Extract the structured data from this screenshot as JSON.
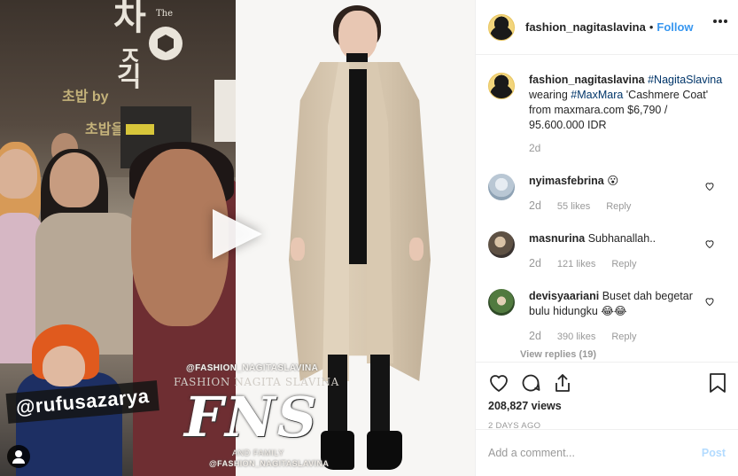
{
  "header": {
    "username": "fashion_nagitaslavina",
    "separator": "•",
    "follow_label": "Follow"
  },
  "caption": {
    "username": "fashion_nagitaslavina",
    "hashtag1": "#NagitaSlavina",
    "text1": "wearing",
    "hashtag2": "#MaxMara",
    "text2": "'Cashmere Coat' from maxmara.com $6,790 / 95.600.000 IDR",
    "age": "2d"
  },
  "comments": [
    {
      "username": "nyimasfebrina",
      "text": "😮",
      "age": "2d",
      "likes": "55 likes",
      "reply_label": "Reply"
    },
    {
      "username": "masnurina",
      "text": "Subhanallah..",
      "age": "2d",
      "likes": "121 likes",
      "reply_label": "Reply"
    },
    {
      "username": "devisyaariani",
      "text": "Buset dah begetar bulu hidungku 😂😂",
      "age": "2d",
      "likes": "390 likes",
      "reply_label": "Reply",
      "view_replies": "View replies (19)"
    }
  ],
  "stats": {
    "views": "208,827 views",
    "timestamp": "2 DAYS AGO"
  },
  "comment_box": {
    "placeholder": "Add a comment...",
    "post_label": "Post"
  },
  "media": {
    "tag_rufus": "@rufusazarya",
    "watermark_handle": "@FASHION_NAGITASLAVINA",
    "watermark_brand": "FASHION NAGITA SLAVINA",
    "watermark_logo": "FNS",
    "watermark_family": "AND FAMILY",
    "watermark_handle2": "@FASHION_NAGITASLAVINA",
    "banner_text1": "The",
    "banner_text2": "by"
  },
  "colors": {
    "link": "#003569",
    "follow": "#3897f0",
    "muted": "#999999",
    "post_disabled": "#b3dbff"
  }
}
